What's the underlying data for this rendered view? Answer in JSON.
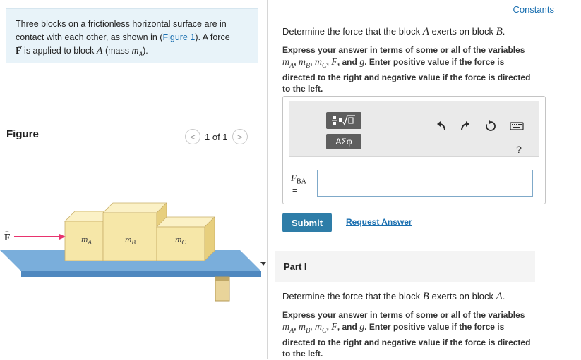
{
  "problem": {
    "text_1": "Three blocks on a frictionless horizontal surface are in contact with each other, as shown in (",
    "figure_link": "Figure 1",
    "text_2": "). A force",
    "force_symbol": "F",
    "text_3": "is applied to block",
    "block_a": "A",
    "text_4": "(mass",
    "mass_symbol": "m",
    "mass_sub": "A",
    "text_5": ")."
  },
  "figure": {
    "title": "Figure",
    "pager": "1 of 1",
    "prev_symbol": "<",
    "next_symbol": ">",
    "force_label": "F",
    "blocks": [
      {
        "var": "m",
        "sub": "A"
      },
      {
        "var": "m",
        "sub": "B"
      },
      {
        "var": "m",
        "sub": "C"
      }
    ]
  },
  "header": {
    "constants_link": "Constants"
  },
  "question1": {
    "text_1": "Determine the force that the block",
    "block_from": "A",
    "text_2": "exerts on block",
    "block_to": "B",
    "text_3": "."
  },
  "instructions": {
    "line_1": "Express your answer in terms of some or all of the variables",
    "vars": [
      {
        "var": "m",
        "sub": "A"
      },
      {
        "var": "m",
        "sub": "B"
      },
      {
        "var": "m",
        "sub": "C"
      }
    ],
    "var_f": "F",
    "and": ", and",
    "var_g": "g",
    "line_2": ". Enter positive value if the force is directed to the right and negative value if the force is directed to the left."
  },
  "toolbar": {
    "template_icon": "radical-fraction-icon",
    "greek_label": "ΑΣφ",
    "help_label": "?"
  },
  "answer": {
    "variable": "F",
    "variable_sub": "BA",
    "equals": "=",
    "value": ""
  },
  "actions": {
    "submit_label": "Submit",
    "request_label": "Request Answer"
  },
  "part": {
    "label": "Part I"
  },
  "question2": {
    "text_1": "Determine the force that the block",
    "block_from": "B",
    "text_2": "exerts on block",
    "block_to": "A",
    "text_3": "."
  },
  "colors": {
    "accent": "#2e7da8",
    "link": "#1a6fb0",
    "problem_bg": "#e8f3f9",
    "force_arrow": "#e8336e",
    "block_face": "#f6e7a8",
    "table_top": "#7aaedb"
  }
}
